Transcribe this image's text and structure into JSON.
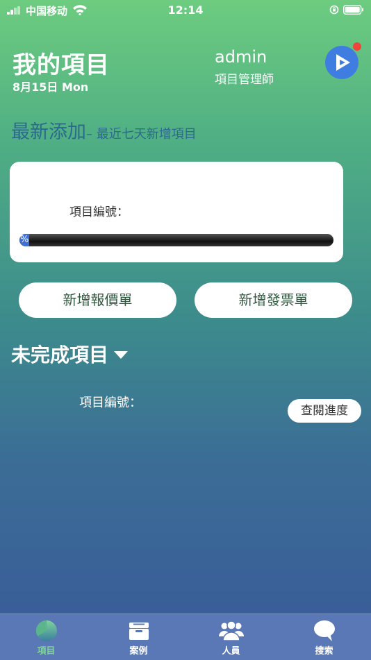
{
  "status_bar": {
    "carrier": "中国移动",
    "time": "12:14"
  },
  "header": {
    "title": "我的項目",
    "date": "8月15日 Mon",
    "username": "admin",
    "role": "項目管理師",
    "notification_dot_color": "#f0453a"
  },
  "recent": {
    "heading": "最新添加",
    "subheading": "– 最近七天新增項目",
    "card": {
      "project_label": "項目編號：",
      "progress_text": "%",
      "progress_fraction": 0
    }
  },
  "actions": {
    "new_quote": "新增報價單",
    "new_invoice": "新增發票單"
  },
  "incomplete": {
    "heading": "未完成項目",
    "project_label": "項目編號：",
    "view_progress_button": "查閱進度"
  },
  "tabs": [
    {
      "label": "項目",
      "icon": "pie-chart-icon",
      "active": true
    },
    {
      "label": "案例",
      "icon": "case-box-icon",
      "active": false
    },
    {
      "label": "人員",
      "icon": "people-icon",
      "active": false
    },
    {
      "label": "搜索",
      "icon": "search-bubble-icon",
      "active": false
    }
  ],
  "colors": {
    "accent": "#3f7de0",
    "tab_active": "#7fd39a",
    "tab_bar": "#5a78b5",
    "section_heading": "#2b6a8d"
  }
}
